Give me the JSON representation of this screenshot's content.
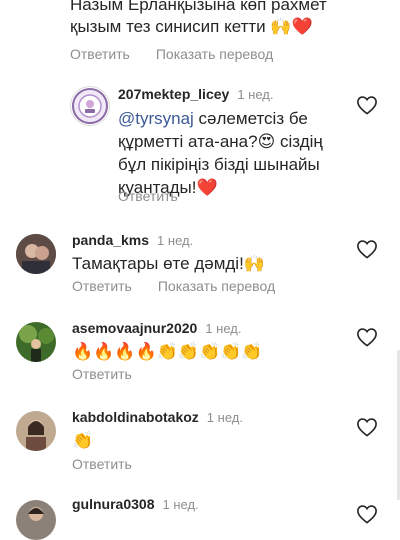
{
  "top_comment": {
    "line1": "Назым Ерланқызына көп рахмет",
    "line2": "қызым тез синисип кетти 🙌❤️",
    "reply_label": "Ответить",
    "translate_label": "Показать перевод"
  },
  "reply_comment": {
    "username": "207mektep_licey",
    "time": "1 нед.",
    "mention": "@tyrsynaj",
    "line1_rest": " сәлеметсіз бе",
    "line2": "құрметті ата-ана?😍 сіздің",
    "line3": "бұл пікіріңіз бізді шынайы",
    "line4": "қуантады!❤️",
    "reply_label": "Ответить"
  },
  "comments": [
    {
      "username": "panda_kms",
      "time": "1 нед.",
      "text": "Тамақтары өте дәмді!🙌",
      "reply_label": "Ответить",
      "translate_label": "Показать перевод"
    },
    {
      "username": "asemovaajnur2020",
      "time": "1 нед.",
      "text": "🔥🔥🔥🔥👏👏👏👏👏",
      "reply_label": "Ответить"
    },
    {
      "username": "kabdoldinabotakoz",
      "time": "1 нед.",
      "text": "👏",
      "reply_label": "Ответить"
    },
    {
      "username": "gulnura0308",
      "time": "1 нед."
    }
  ],
  "colors": {
    "text": "#262626",
    "muted": "#8e8e8e",
    "mention": "#3b5a96"
  }
}
